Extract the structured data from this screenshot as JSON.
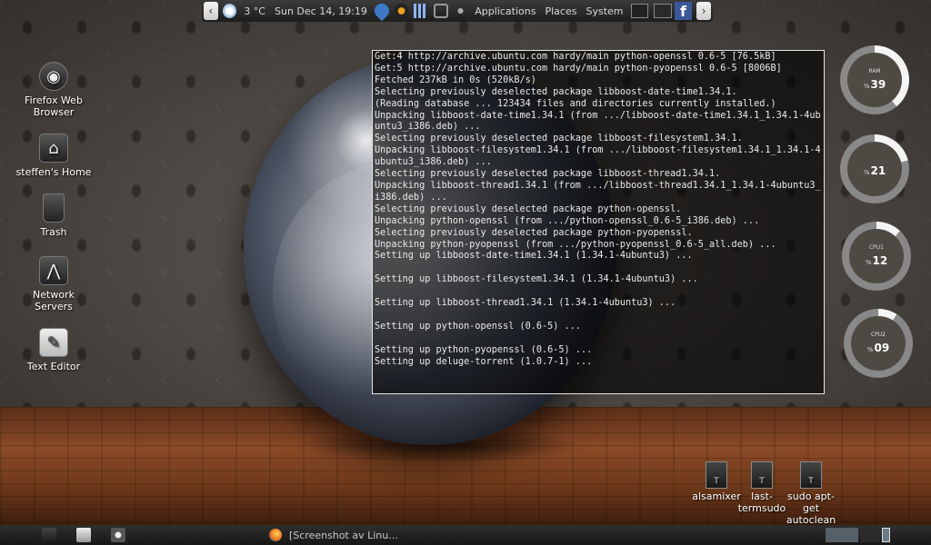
{
  "top_panel": {
    "weather": "3 °C",
    "datetime": "Sun Dec 14, 19:19",
    "menus": [
      "Applications",
      "Places",
      "System"
    ],
    "left_arrow": "‹",
    "right_arrow": "›",
    "facebook": "f"
  },
  "desktop_icons": [
    {
      "label": "Firefox Web Browser",
      "icon": "globe-icon"
    },
    {
      "label": "steffen's Home",
      "icon": "home-icon"
    },
    {
      "label": "Trash",
      "icon": "trash-icon"
    },
    {
      "label": "Network Servers",
      "icon": "network-icon"
    },
    {
      "label": "Text Editor",
      "icon": "text-editor-icon"
    }
  ],
  "terminal_lines": [
    "Get:4 http://archive.ubuntu.com hardy/main python-openssl 0.6-5 [76.5kB]",
    "Get:5 http://archive.ubuntu.com hardy/main python-pyopenssl 0.6-5 [8006B]",
    "Fetched 237kB in 0s (520kB/s)",
    "Selecting previously deselected package libboost-date-time1.34.1.",
    "(Reading database ... 123434 files and directories currently installed.)",
    "Unpacking libboost-date-time1.34.1 (from .../libboost-date-time1.34.1_1.34.1-4ubuntu3_i386.deb) ...",
    "Selecting previously deselected package libboost-filesystem1.34.1.",
    "Unpacking libboost-filesystem1.34.1 (from .../libboost-filesystem1.34.1_1.34.1-4ubuntu3_i386.deb) ...",
    "Selecting previously deselected package libboost-thread1.34.1.",
    "Unpacking libboost-thread1.34.1 (from .../libboost-thread1.34.1_1.34.1-4ubuntu3_i386.deb) ...",
    "Selecting previously deselected package python-openssl.",
    "Unpacking python-openssl (from .../python-openssl_0.6-5_i386.deb) ...",
    "Selecting previously deselected package python-pyopenssl.",
    "Unpacking python-pyopenssl (from .../python-pyopenssl_0.6-5_all.deb) ...",
    "Setting up libboost-date-time1.34.1 (1.34.1-4ubuntu3) ...",
    "",
    "Setting up libboost-filesystem1.34.1 (1.34.1-4ubuntu3) ...",
    "",
    "Setting up libboost-thread1.34.1 (1.34.1-4ubuntu3) ...",
    "",
    "Setting up python-openssl (0.6-5) ...",
    "",
    "Setting up python-pyopenssl (0.6-5) ...",
    "Setting up deluge-torrent (1.0.7-1) ..."
  ],
  "gauges": [
    {
      "label": "RAM",
      "value": "39",
      "pct": 39
    },
    {
      "label": "",
      "value": "21",
      "pct": 21
    },
    {
      "label": "CPU1",
      "value": "12",
      "pct": 12
    },
    {
      "label": "CPU2",
      "value": "09",
      "pct": 9
    }
  ],
  "gauge_unit": "%",
  "launchers": [
    {
      "label": "alsamixer",
      "glyph": "T"
    },
    {
      "label": "last-termsudo",
      "glyph": "T"
    },
    {
      "label": "sudo apt-get autoclean",
      "glyph": "T"
    }
  ],
  "bottom_panel": {
    "task_label": "[Screenshot av Linu..."
  }
}
